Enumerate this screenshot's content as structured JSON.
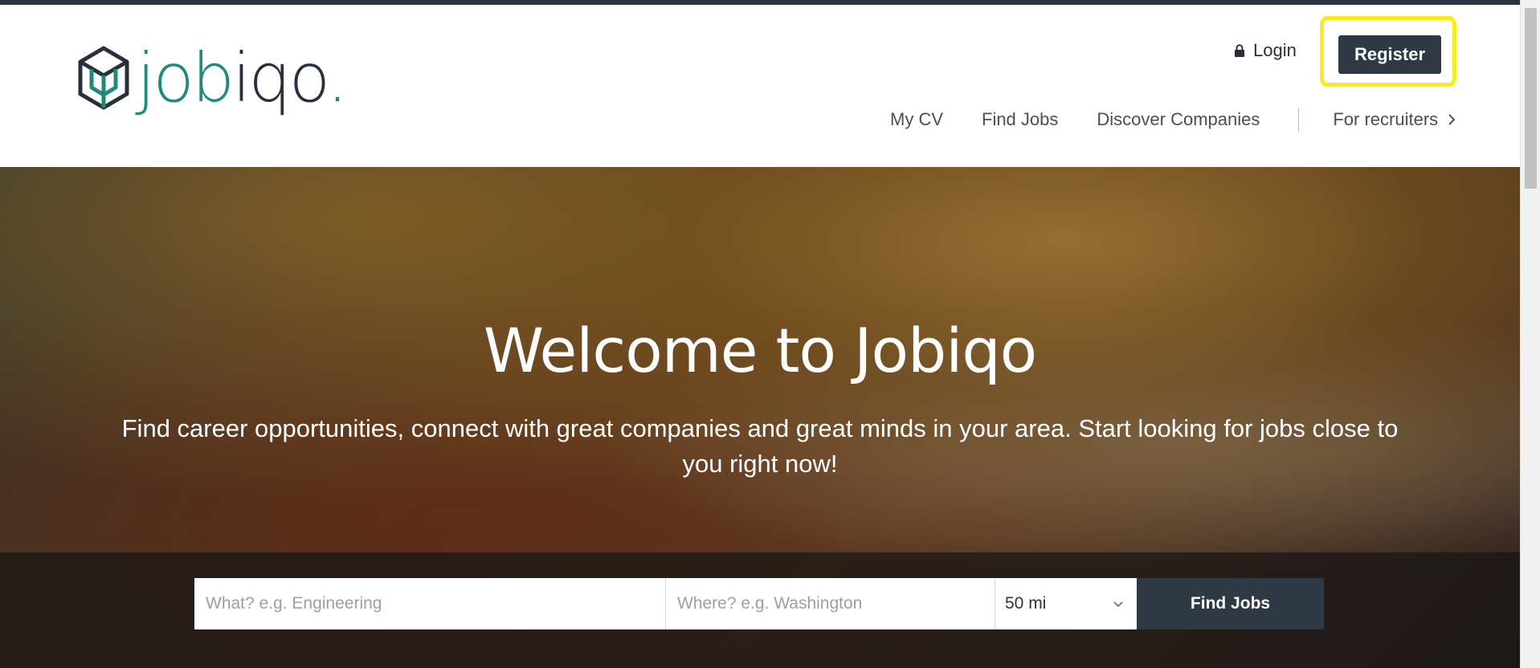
{
  "header": {
    "logo_text_part1": "job",
    "logo_text_part2": "iq",
    "logo_text_part3": "o",
    "logo_dot": ".",
    "login_label": "Login",
    "register_label": "Register",
    "nav": [
      {
        "label": "My CV"
      },
      {
        "label": "Find Jobs"
      },
      {
        "label": "Discover Companies"
      }
    ],
    "recruiters_label": "For recruiters"
  },
  "hero": {
    "title": "Welcome to Jobiqo",
    "subtitle": "Find career opportunities, connect with great companies and great minds in your area. Start looking for jobs close to you right now!"
  },
  "search": {
    "what_placeholder": "What? e.g. Engineering",
    "where_placeholder": "Where? e.g. Washington",
    "radius_value": "50 mi",
    "submit_label": "Find Jobs"
  },
  "colors": {
    "brand_teal": "#1f8a78",
    "brand_dark": "#2a2f3c",
    "button_dark": "#2e3944",
    "highlight": "#f6ee1a"
  },
  "icons": {
    "logo": "cube-logo-icon",
    "login": "lock-icon",
    "recruiters": "chevron-right-icon",
    "radius": "chevron-down-icon"
  }
}
